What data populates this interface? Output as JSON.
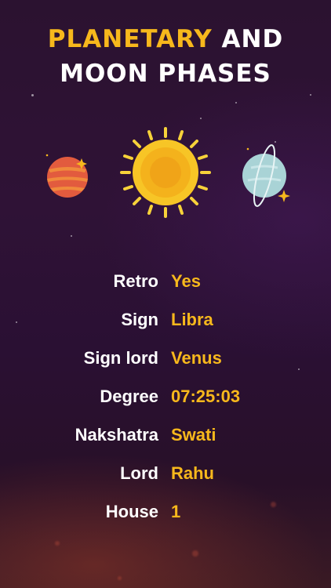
{
  "title": {
    "highlight": "PLANETARY",
    "line1_rest": "AND",
    "line2": "MOON PHASES"
  },
  "colors": {
    "accent": "#f7b81c",
    "text": "#ffffff",
    "background": "#2c1233"
  },
  "illustrations": [
    "mars-planet-icon",
    "sun-icon",
    "uranus-planet-icon"
  ],
  "details": [
    {
      "label": "Retro",
      "value": "Yes"
    },
    {
      "label": "Sign",
      "value": "Libra"
    },
    {
      "label": "Sign lord",
      "value": "Venus"
    },
    {
      "label": "Degree",
      "value": "07:25:03"
    },
    {
      "label": "Nakshatra",
      "value": "Swati"
    },
    {
      "label": "Lord",
      "value": "Rahu"
    },
    {
      "label": "House",
      "value": "1"
    }
  ]
}
